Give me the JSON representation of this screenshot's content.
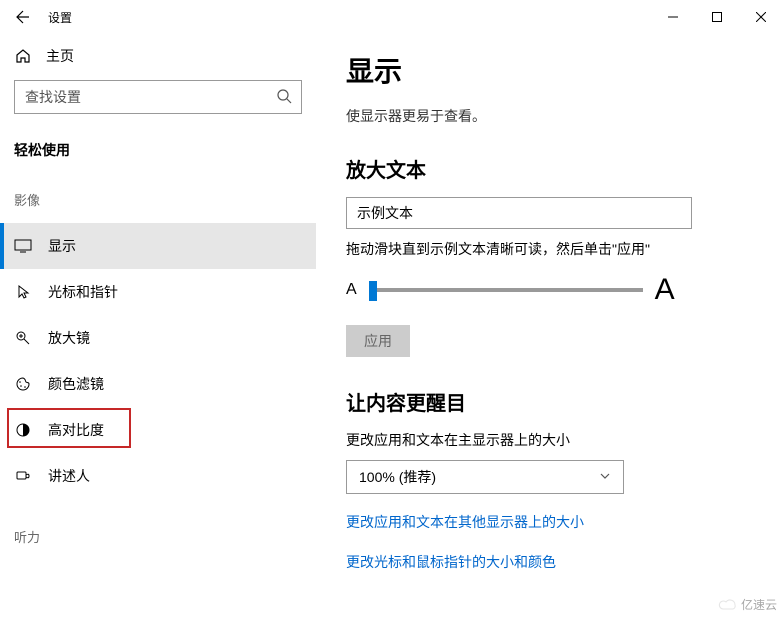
{
  "window": {
    "title": "设置"
  },
  "sidebar": {
    "home": "主页",
    "search_placeholder": "查找设置",
    "section": "轻松使用",
    "group_visual": "影像",
    "group_hearing": "听力",
    "items": [
      {
        "label": "显示"
      },
      {
        "label": "光标和指针"
      },
      {
        "label": "放大镜"
      },
      {
        "label": "颜色滤镜"
      },
      {
        "label": "高对比度"
      },
      {
        "label": "讲述人"
      }
    ]
  },
  "main": {
    "title": "显示",
    "desc": "使显示器更易于查看。",
    "enlarge_heading": "放大文本",
    "sample_text": "示例文本",
    "slider_desc": "拖动滑块直到示例文本清晰可读，然后单击\"应用\"",
    "small_a": "A",
    "big_a": "A",
    "apply": "应用",
    "prominent_heading": "让内容更醒目",
    "scale_desc": "更改应用和文本在主显示器上的大小",
    "scale_value": "100% (推荐)",
    "link_other_displays": "更改应用和文本在其他显示器上的大小",
    "link_cursor": "更改光标和鼠标指针的大小和颜色"
  },
  "watermark": "亿速云"
}
